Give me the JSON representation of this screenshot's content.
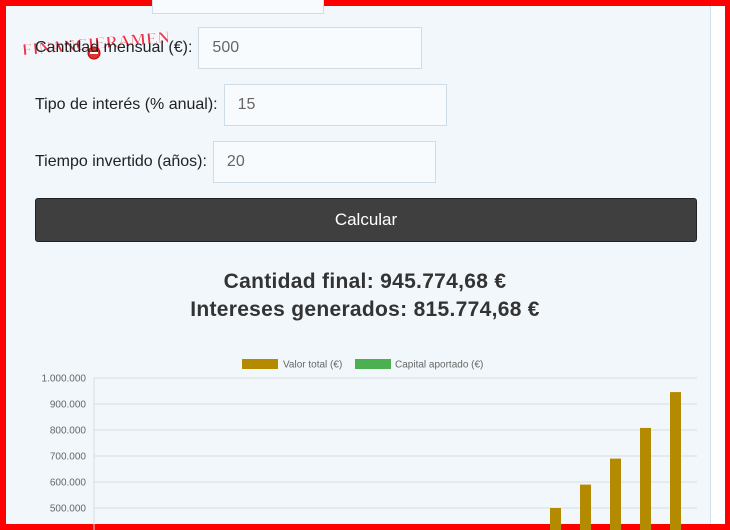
{
  "brand": {
    "logo_text": "FINANCIERAMENTE"
  },
  "form": {
    "monthly_label": "Cantidad mensual (€):",
    "monthly_value": "500",
    "rate_label": "Tipo de interés (% anual):",
    "rate_value": "15",
    "years_label": "Tiempo invertido (años):",
    "years_value": "20",
    "calculate_label": "Calcular"
  },
  "results": {
    "final_amount": "Cantidad final: 945.774,68 €",
    "interest_generated": "Intereses generados: 815.774,68 €"
  },
  "colors": {
    "total_value": "#b38a00",
    "capital": "#4caf50",
    "button_bg": "#3f3f3f",
    "frame": "#ff0000"
  },
  "chart_data": {
    "type": "bar",
    "legend": [
      "Valor total (€)",
      "Capital aportado (€)"
    ],
    "legend_position": "top",
    "y_ticks": [
      "1.000.000",
      "900.000",
      "800.000",
      "700.000",
      "600.000",
      "500.000"
    ],
    "ylim": [
      0,
      1000000
    ],
    "grid": true,
    "series": [
      {
        "name": "Valor total (€)",
        "values": [
          500000,
          590000,
          690000,
          808000,
          945775
        ]
      }
    ]
  }
}
